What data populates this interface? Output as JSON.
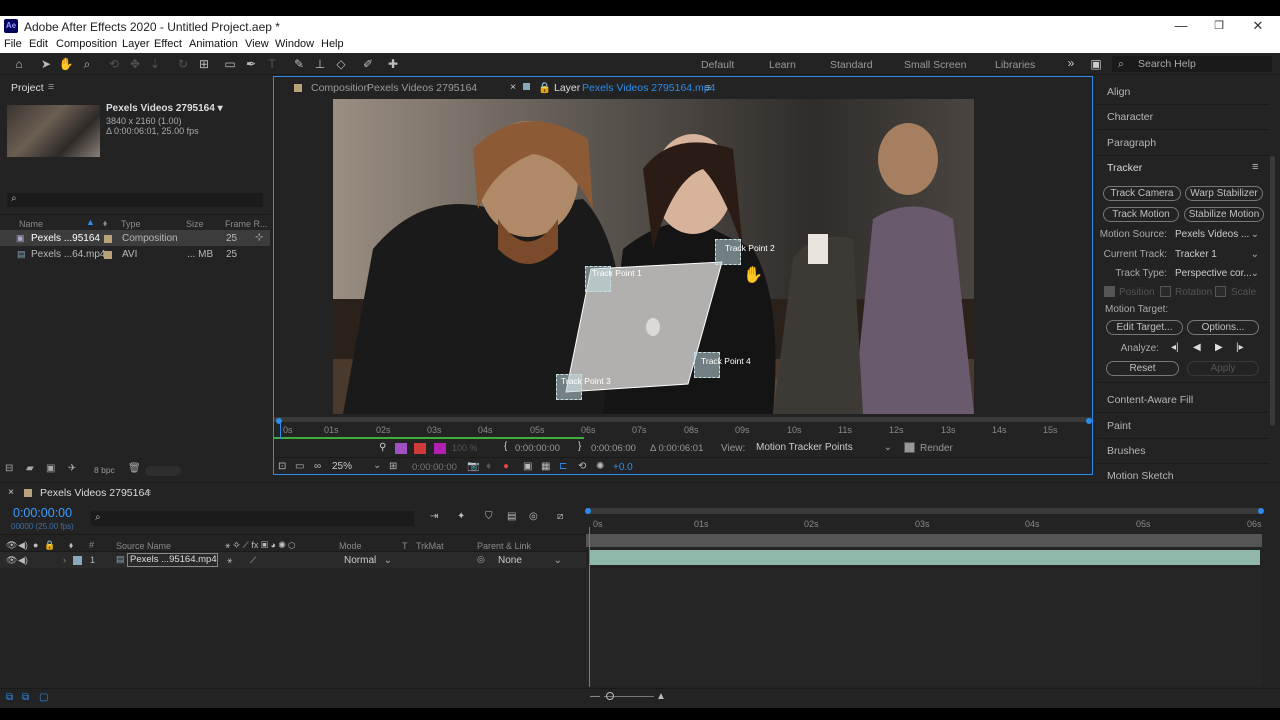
{
  "window": {
    "title": "Adobe After Effects 2020 - Untitled Project.aep *",
    "app_icon": "Ae"
  },
  "menu": [
    "File",
    "Edit",
    "Composition",
    "Layer",
    "Effect",
    "Animation",
    "View",
    "Window",
    "Help"
  ],
  "workspaces": [
    "Default",
    "Learn",
    "Standard",
    "Small Screen",
    "Libraries"
  ],
  "search_help": "Search Help",
  "project": {
    "tab": "Project",
    "item_name": "Pexels Videos 2795164 ▾",
    "item_info1": "3840 x 2160 (1.00)",
    "item_info2": "Δ 0:00:06:01, 25.00 fps",
    "search_placeholder": "",
    "columns": {
      "name": "Name",
      "type": "Type",
      "size": "Size",
      "frame": "Frame R..."
    },
    "rows": [
      {
        "name": "Pexels ...95164",
        "type": "Composition",
        "size": "",
        "frame": "25"
      },
      {
        "name": "Pexels ...64.mp4",
        "type": "AVI",
        "size": "... MB",
        "frame": "25"
      }
    ],
    "bpc": "8 bpc"
  },
  "viewer": {
    "tab_comp_prefix": "Composition",
    "tab_comp_name": "Pexels Videos 2795164",
    "tab_layer_prefix": "Layer",
    "tab_layer_name": "Pexels Videos 2795164.mp4",
    "track_points": [
      "Track Point 1",
      "Track Point 2",
      "Track Point 3",
      "Track Point 4"
    ],
    "ruler": [
      "0s",
      "01s",
      "02s",
      "03s",
      "04s",
      "05s",
      "06s",
      "07s",
      "08s",
      "09s",
      "10s",
      "11s",
      "12s",
      "13s",
      "14s",
      "15s"
    ],
    "zoom_pct": "100 %",
    "in_time": "0:00:00:00",
    "out_time": "0:00:06:00",
    "duration": "Δ 0:00:06:01",
    "view_label": "View:",
    "view_value": "Motion Tracker Points",
    "render_label": "Render",
    "magnification": "25%",
    "current_time": "0:00:00:00",
    "exposure": "+0.0"
  },
  "right_panel": {
    "sections_top": [
      "Align",
      "Character",
      "Paragraph"
    ],
    "tracker_title": "Tracker",
    "buttons": {
      "track_camera": "Track Camera",
      "warp_stabilizer": "Warp Stabilizer",
      "track_motion": "Track Motion",
      "stabilize_motion": "Stabilize Motion",
      "edit_target": "Edit Target...",
      "options": "Options...",
      "reset": "Reset",
      "apply": "Apply"
    },
    "motion_source_label": "Motion Source:",
    "motion_source_value": "Pexels Videos ...",
    "current_track_label": "Current Track:",
    "current_track_value": "Tracker 1",
    "track_type_label": "Track Type:",
    "track_type_value": "Perspective cor...",
    "checkboxes": [
      "Position",
      "Rotation",
      "Scale"
    ],
    "motion_target_label": "Motion Target:",
    "analyze_label": "Analyze:",
    "sections_bottom": [
      "Content-Aware Fill",
      "Paint",
      "Brushes",
      "Motion Sketch"
    ]
  },
  "timeline": {
    "tab": "Pexels Videos 2795164",
    "timecode": "0:00:00:00",
    "fps": "00000 (25.00 fps)",
    "columns": {
      "source": "Source Name",
      "mode": "Mode",
      "t": "T",
      "trkmat": "TrkMat",
      "parent": "Parent & Link"
    },
    "layer": {
      "num": "1",
      "name": "Pexels ...95164.mp4",
      "mode": "Normal",
      "parent": "None"
    },
    "ruler": [
      "0s",
      "01s",
      "02s",
      "03s",
      "04s",
      "05s",
      "06s"
    ]
  },
  "colors": {
    "accent": "#2d8ceb",
    "timecode": "#3d9bff",
    "track_bar": "#8fb8ab"
  }
}
